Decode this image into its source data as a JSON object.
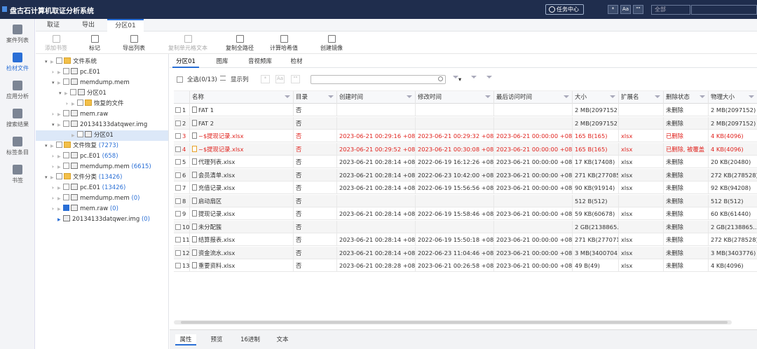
{
  "app": {
    "title": "盘古石计算机取证分析系统",
    "task_center": "任务中心",
    "scope_select": "全部",
    "toolbar_icons": [
      "*",
      "Aa",
      "\"\""
    ]
  },
  "nav": [
    {
      "label": "案件列表",
      "icon": "case-icon"
    },
    {
      "label": "检材文件",
      "icon": "layers-icon",
      "active": true
    },
    {
      "label": "应用分析",
      "icon": "grid-icon"
    },
    {
      "label": "搜索结果",
      "icon": "search-result-icon"
    },
    {
      "label": "标签条目",
      "icon": "tag-icon"
    },
    {
      "label": "书签",
      "icon": "bookmark-icon"
    }
  ],
  "tabs": [
    {
      "label": "取证"
    },
    {
      "label": "导出"
    },
    {
      "label": "分区01",
      "active": true
    }
  ],
  "toolbar": [
    {
      "label": "添加书签",
      "disabled": true
    },
    {
      "label": "标记"
    },
    {
      "label": "导出列表"
    },
    {
      "label": "复制单元格文本",
      "disabled": true
    },
    {
      "label": "复制全路径"
    },
    {
      "label": "计算哈希值"
    },
    {
      "label": "创建镜像"
    }
  ],
  "tree": [
    {
      "label": "文件系统",
      "level": 0,
      "icon": "folder"
    },
    {
      "label": "pc.E01",
      "level": 1,
      "icon": "drive"
    },
    {
      "label": "memdump.mem",
      "level": 1,
      "icon": "drive"
    },
    {
      "label": "分区01",
      "level": 2,
      "icon": "drive"
    },
    {
      "label": "恢复的文件",
      "level": 3,
      "icon": "folder"
    },
    {
      "label": "mem.raw",
      "level": 1,
      "icon": "drive"
    },
    {
      "label": "20134133datqwer.img",
      "level": 1,
      "icon": "drive"
    },
    {
      "label": "分区01",
      "level": 2,
      "icon": "drive",
      "selected": true
    },
    {
      "label": "文件恢复",
      "count": "(7273)",
      "level": 0,
      "icon": "folder"
    },
    {
      "label": "pc.E01",
      "count": "(658)",
      "level": 1,
      "icon": "drive"
    },
    {
      "label": "memdump.mem",
      "count": "(6615)",
      "level": 1,
      "icon": "drive"
    },
    {
      "label": "文件分类",
      "count": "(13426)",
      "level": 0,
      "icon": "folder"
    },
    {
      "label": "pc.E01",
      "count": "(13426)",
      "level": 1,
      "icon": "drive"
    },
    {
      "label": "memdump.mem",
      "count": "(0)",
      "level": 1,
      "icon": "drive"
    },
    {
      "label": "mem.raw",
      "count": "(0)",
      "level": 1,
      "icon": "drive",
      "checked": true
    },
    {
      "label": "20134133datqwer.img",
      "count": "(0)",
      "level": 1,
      "icon": "drive"
    }
  ],
  "subtabs": [
    {
      "label": "分区01",
      "active": true
    },
    {
      "label": "图库"
    },
    {
      "label": "音视频库"
    },
    {
      "label": "检材"
    }
  ],
  "list": {
    "select_all": "全选(0/13)",
    "show_columns": "显示列",
    "search_placeholder": ""
  },
  "columns": [
    "名称",
    "目录",
    "创建时间",
    "修改时间",
    "最后访问时间",
    "大小",
    "扩展名",
    "删除状态",
    "物理大小"
  ],
  "rows": [
    {
      "n": "1",
      "name": "FAT 1",
      "dir": "否",
      "ct": "",
      "mt": "",
      "at": "",
      "size": "2 MB(2097152)",
      "ext": "",
      "del": "未删除",
      "phys": "2 MB(2097152)"
    },
    {
      "n": "2",
      "name": "FAT 2",
      "dir": "否",
      "ct": "",
      "mt": "",
      "at": "",
      "size": "2 MB(2097152)",
      "ext": "",
      "del": "未删除",
      "phys": "2 MB(2097152)"
    },
    {
      "n": "3",
      "name": "~$提现记录.xlsx",
      "dir": "否",
      "ct": "2023-06-21 00:29:16 +08",
      "mt": "2023-06-21 00:29:32 +08",
      "at": "2023-06-21 00:00:00 +08",
      "size": "165 B(165)",
      "ext": "xlsx",
      "del": "已删除",
      "phys": "4 KB(4096)",
      "red": true
    },
    {
      "n": "4",
      "name": "~$提现记录.xlsx",
      "dir": "否",
      "ct": "2023-06-21 00:29:52 +08",
      "mt": "2023-06-21 00:30:08 +08",
      "at": "2023-06-21 00:00:00 +08",
      "size": "165 B(165)",
      "ext": "xlsx",
      "del": "已删除, 被覆盖",
      "phys": "4 KB(4096)",
      "red": true,
      "warn": true
    },
    {
      "n": "5",
      "name": "代理列表.xlsx",
      "dir": "否",
      "ct": "2023-06-21 00:28:14 +08",
      "mt": "2022-06-19 16:12:26 +08",
      "at": "2023-06-21 00:00:00 +08",
      "size": "17 KB(17408)",
      "ext": "xlsx",
      "del": "未删除",
      "phys": "20 KB(20480)"
    },
    {
      "n": "6",
      "name": "会员清单.xlsx",
      "dir": "否",
      "ct": "2023-06-21 00:28:14 +08",
      "mt": "2022-06-23 10:42:00 +08",
      "at": "2023-06-21 00:00:00 +08",
      "size": "271 KB(277085)",
      "ext": "xlsx",
      "del": "未删除",
      "phys": "272 KB(278528)"
    },
    {
      "n": "7",
      "name": "充值记录.xlsx",
      "dir": "否",
      "ct": "2023-06-21 00:28:14 +08",
      "mt": "2022-06-19 15:56:56 +08",
      "at": "2023-06-21 00:00:00 +08",
      "size": "90 KB(91914)",
      "ext": "xlsx",
      "del": "未删除",
      "phys": "92 KB(94208)"
    },
    {
      "n": "8",
      "name": "启动扇区",
      "dir": "否",
      "ct": "",
      "mt": "",
      "at": "",
      "size": "512 B(512)",
      "ext": "",
      "del": "未删除",
      "phys": "512 B(512)"
    },
    {
      "n": "9",
      "name": "提现记录.xlsx",
      "dir": "否",
      "ct": "2023-06-21 00:28:14 +08",
      "mt": "2022-06-19 15:58:46 +08",
      "at": "2023-06-21 00:00:00 +08",
      "size": "59 KB(60678)",
      "ext": "xlsx",
      "del": "未删除",
      "phys": "60 KB(61440)"
    },
    {
      "n": "10",
      "name": "未分配簇",
      "dir": "否",
      "ct": "",
      "mt": "",
      "at": "",
      "size": "2 GB(2138865...",
      "ext": "",
      "del": "未删除",
      "phys": "2 GB(2138865..."
    },
    {
      "n": "11",
      "name": "结算报表.xlsx",
      "dir": "否",
      "ct": "2023-06-21 00:28:14 +08",
      "mt": "2022-06-19 15:50:18 +08",
      "at": "2023-06-21 00:00:00 +08",
      "size": "271 KB(277071)",
      "ext": "xlsx",
      "del": "未删除",
      "phys": "272 KB(278528)"
    },
    {
      "n": "12",
      "name": "资金流水.xlsx",
      "dir": "否",
      "ct": "2023-06-21 00:28:14 +08",
      "mt": "2022-06-23 11:04:46 +08",
      "at": "2023-06-21 00:00:00 +08",
      "size": "3 MB(3400704)",
      "ext": "xlsx",
      "del": "未删除",
      "phys": "3 MB(3403776)"
    },
    {
      "n": "13",
      "name": "重要资料.xlsx",
      "dir": "否",
      "ct": "2023-06-21 00:28:28 +08",
      "mt": "2023-06-21 00:26:58 +08",
      "at": "2023-06-21 00:00:00 +08",
      "size": "49 B(49)",
      "ext": "xlsx",
      "del": "未删除",
      "phys": "4 KB(4096)"
    }
  ],
  "bottom_tabs": [
    {
      "label": "属性",
      "active": true
    },
    {
      "label": "预览"
    },
    {
      "label": "16进制"
    },
    {
      "label": "文本"
    }
  ]
}
